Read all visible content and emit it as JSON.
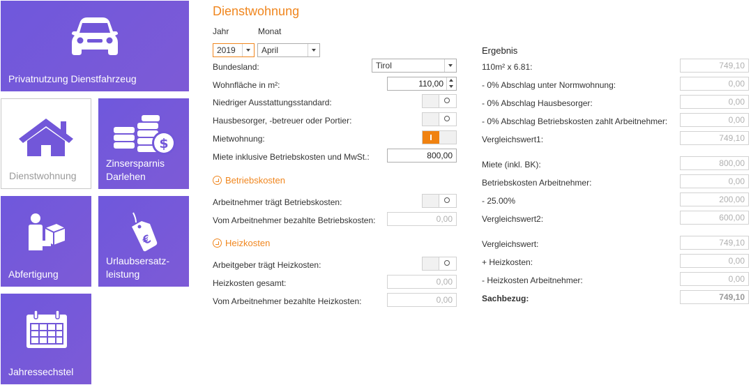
{
  "tiles": {
    "car": "Privatnutzung Dienstfahrzeug",
    "house": "Dienstwohnung",
    "coins": "Zinsersparnis Darlehen",
    "abfertigung": "Abfertigung",
    "urlaub": "Urlaubsersatz-\nleistung",
    "calendar": "Jahressechstel"
  },
  "form": {
    "title": "Dienstwohnung",
    "jahr_label": "Jahr",
    "monat_label": "Monat",
    "jahr_value": "2019",
    "monat_value": "April",
    "bundesland_label": "Bundesland:",
    "bundesland_value": "Tirol",
    "wohnflaeche_label": "Wohnfläche in m²:",
    "wohnflaeche_value": "110,00",
    "niedriger_label": "Niedriger Ausstattungsstandard:",
    "hausbesorger_label": "Hausbesorger, -betreuer oder Portier:",
    "mietwohnung_label": "Mietwohnung:",
    "miete_label": "Miete inklusive Betriebskosten und MwSt.:",
    "miete_value": "800,00",
    "betriebskosten_section": "Betriebskosten",
    "an_traegt_bk_label": "Arbeitnehmer trägt Betriebskosten:",
    "an_bezahlte_bk_label": "Vom Arbeitnehmer bezahlte Betriebskosten:",
    "an_bezahlte_bk_value": "0,00",
    "heizkosten_section": "Heizkosten",
    "ag_traegt_hk_label": "Arbeitgeber trägt Heizkosten:",
    "hk_gesamt_label": "Heizkosten gesamt:",
    "hk_gesamt_value": "0,00",
    "an_bezahlte_hk_label": "Vom Arbeitnehmer bezahlte Heizkosten:",
    "an_bezahlte_hk_value": "0,00"
  },
  "result": {
    "heading": "Ergebnis",
    "rows": [
      {
        "label": "110m² x 6.81:",
        "value": "749,10"
      },
      {
        "label": "- 0% Abschlag unter Normwohnung:",
        "value": "0,00"
      },
      {
        "label": "- 0% Abschlag Hausbesorger:",
        "value": "0,00"
      },
      {
        "label": "- 0% Abschlag Betriebskosten zahlt Arbeitnehmer:",
        "value": "0,00"
      },
      {
        "label": "Vergleichswert1:",
        "value": "749,10"
      },
      {
        "label": "Miete (inkl. BK):",
        "value": "800,00"
      },
      {
        "label": "Betriebskosten Arbeitnehmer:",
        "value": "0,00"
      },
      {
        "label": "- 25.00%",
        "value": "200,00"
      },
      {
        "label": "Vergleichswert2:",
        "value": "600,00"
      },
      {
        "label": "Vergleichswert:",
        "value": "749,10"
      },
      {
        "label": "+ Heizkosten:",
        "value": "0,00"
      },
      {
        "label": "- Heizkosten Arbeitnehmer:",
        "value": "0,00"
      },
      {
        "label": "Sachbezug:",
        "value": "749,10"
      }
    ]
  },
  "colors": {
    "accent": "#f0861e",
    "tile": "#7257d9",
    "toggle_on": "#f08210"
  }
}
